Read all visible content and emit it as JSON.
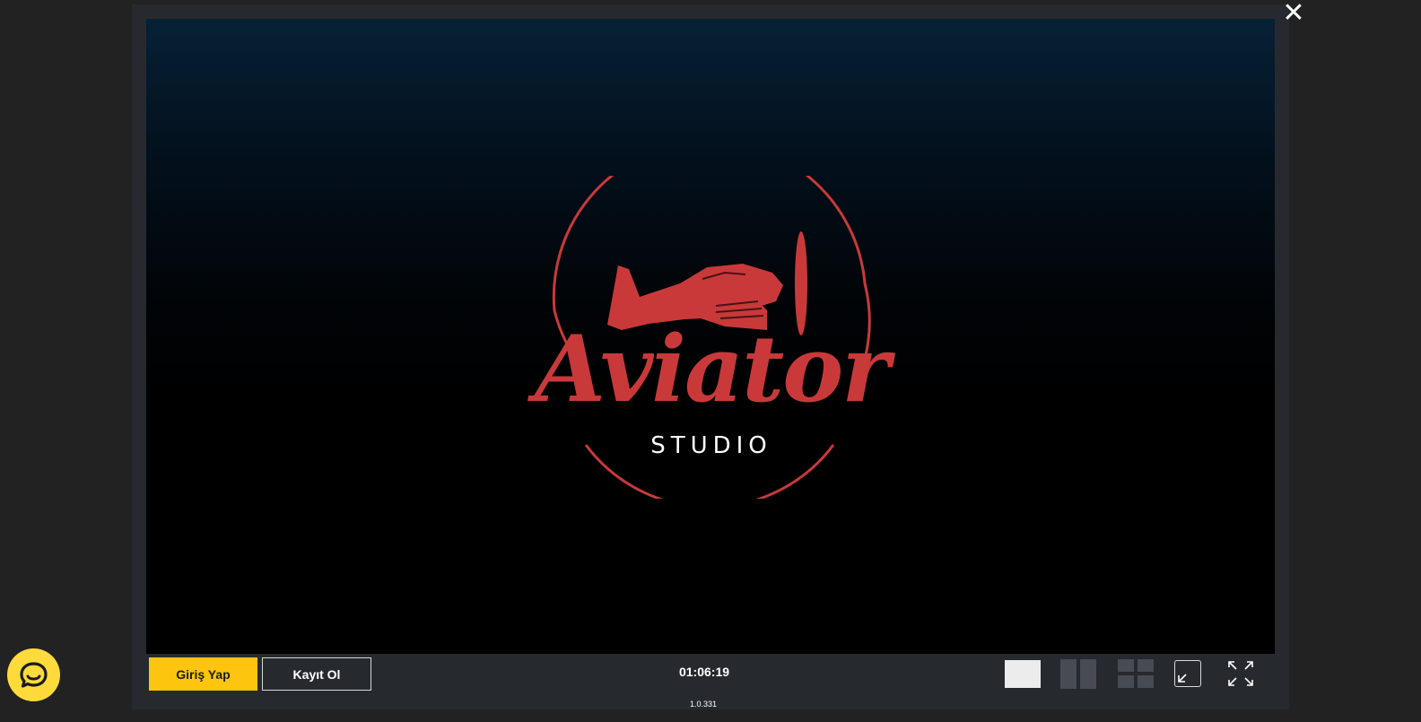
{
  "game": {
    "logo_title": "Aviator",
    "logo_subtitle": "STUDIO",
    "version": "1.0.331"
  },
  "close": {
    "icon": "close-icon",
    "glyph": "✕"
  },
  "bottom_bar": {
    "login_label": "Giriş Yap",
    "register_label": "Kayıt Ol",
    "timer": "01:06:19"
  },
  "controls": {
    "single_view": "single-view-icon",
    "split_view": "two-panel-view-icon",
    "quad_view": "four-panel-view-icon",
    "minimize": "minimize-icon",
    "fullscreen": "fullscreen-icon"
  },
  "chat_widget": {
    "icon": "chat-bubble-icon"
  },
  "colors": {
    "background": "#222222",
    "modal": "#262a2f",
    "logo_red": "#c9393a",
    "login_button": "#fec50e",
    "chat_widget": "#fedb3a"
  }
}
